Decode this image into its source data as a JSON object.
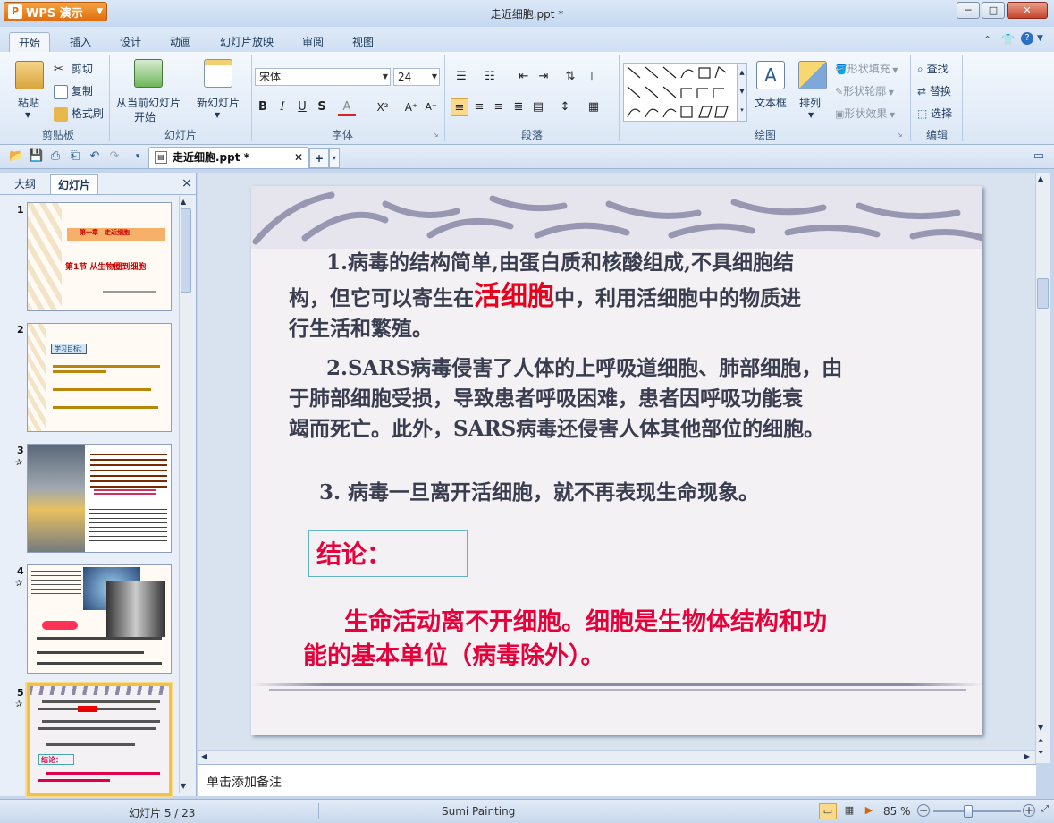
{
  "window": {
    "app_button": "WPS 演示",
    "title": "走近细胞.ppt *",
    "controls": [
      "─",
      "□",
      "✕"
    ]
  },
  "ribbon_tabs": [
    "开始",
    "插入",
    "设计",
    "动画",
    "幻灯片放映",
    "审阅",
    "视图"
  ],
  "ribbon": {
    "clipboard": {
      "paste": "粘贴",
      "cut": "剪切",
      "copy": "复制",
      "format_painter": "格式刷",
      "label": "剪贴板"
    },
    "slides": {
      "from_current": "从当前幻灯片",
      "from_current_2": "开始",
      "new_slide": "新幻灯片",
      "label": "幻灯片"
    },
    "font": {
      "name": "宋体",
      "size": "24",
      "label": "字体",
      "bold": "B",
      "italic": "I",
      "underline": "U",
      "shadow": "S",
      "color": "A",
      "superscript": "X²",
      "grow": "A⁺",
      "shrink": "A⁻"
    },
    "paragraph": {
      "label": "段落"
    },
    "drawing": {
      "textbox": "文本框",
      "arrange": "排列",
      "shape_fill": "形状填充",
      "shape_outline": "形状轮廓",
      "shape_effect": "形状效果",
      "label": "绘图"
    },
    "editing": {
      "find": "查找",
      "replace": "替换",
      "select": "选择",
      "label": "编辑"
    }
  },
  "document_tab": "走近细胞.ppt *",
  "left_panel": {
    "tabs": [
      "大纲",
      "幻灯片"
    ],
    "close": "×",
    "thumbnails": [
      {
        "num": "1",
        "lines": [
          "第一章　走近细胞",
          "第1节 从生物圈到细胞"
        ]
      },
      {
        "num": "2",
        "lines": [
          "学习目标："
        ]
      },
      {
        "num": "3",
        "lines": []
      },
      {
        "num": "4",
        "lines": []
      },
      {
        "num": "5",
        "lines": [
          "结论："
        ]
      }
    ]
  },
  "slide": {
    "para1_a": "1.病毒的结构简单,由蛋白质和核酸组成,不具细胞结",
    "para1_b": "构，但它可以寄生在",
    "para1_highlight": "活细胞",
    "para1_c": "中，利用活细胞中的物质进",
    "para1_d": "行生活和繁殖。",
    "para2_a": "2.SARS病毒侵害了人体的上呼吸道细胞、肺部细胞，由",
    "para2_b": "于肺部细胞受损，导致患者呼吸困难，患者因呼吸功能衰",
    "para2_c": "竭而死亡。此外，SARS病毒还侵害人体其他部位的细胞。",
    "para3": "3. 病毒一旦离开活细胞，就不再表现生命现象。",
    "conclusion_label": "结论：",
    "conclusion_a": "生命活动离不开细胞。细胞是生物体结构和功",
    "conclusion_b": "能的基本单位（病毒除外）。"
  },
  "notes_placeholder": "单击添加备注",
  "status": {
    "slide_count": "幻灯片 5 / 23",
    "theme": "Sumi Painting",
    "zoom": "85 %"
  },
  "colors": {
    "accent_red": "#e8003a",
    "text": "#3a3d4f",
    "highlight_red": "#e8001c"
  }
}
